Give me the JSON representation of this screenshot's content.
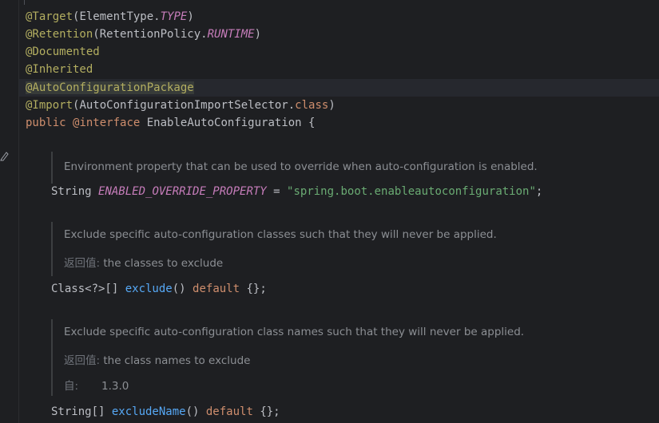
{
  "code": {
    "target": {
      "ann": "@Target",
      "open": "(ElementType.",
      "val": "TYPE",
      "close": ")"
    },
    "retention": {
      "ann": "@Retention",
      "open": "(RetentionPolicy.",
      "val": "RUNTIME",
      "close": ")"
    },
    "documented": "@Documented",
    "inherited": "@Inherited",
    "auto_pkg": "@AutoConfigurationPackage",
    "import": {
      "ann": "@Import",
      "open": "(AutoConfigurationImportSelector.",
      "kw": "class",
      "close": ")"
    },
    "decl": {
      "kw1": "public",
      "kw2": "@interface",
      "name": " EnableAutoConfiguration {"
    },
    "prop": {
      "type": "String ",
      "name": "ENABLED_OVERRIDE_PROPERTY",
      "eq": " = ",
      "value": "\"spring.boot.enableautoconfiguration\"",
      "end": ";"
    },
    "exclude": {
      "type": "Class<?>[] ",
      "name": "exclude",
      "parens": "() ",
      "kw": "default",
      "rest": " {};"
    },
    "exclude_name": {
      "type": "String[] ",
      "name": "excludeName",
      "parens": "() ",
      "kw": "default",
      "rest": " {};"
    }
  },
  "docs": {
    "doc1": "Environment property that can be used to override when auto-configuration is enabled.",
    "doc2": {
      "desc": "Exclude specific auto-configuration classes such that they will never be applied.",
      "returns_label": "返回值:",
      "returns_text": " the classes to exclude"
    },
    "doc3": {
      "desc": "Exclude specific auto-configuration class names such that they will never be applied.",
      "returns_label": "返回值:",
      "returns_text": " the class names to exclude",
      "since_label": "自:",
      "since_value": "1.3.0"
    }
  },
  "colors": {
    "background": "#1e1f22",
    "annotation": "#b3ae60",
    "keyword": "#cf8e6d",
    "constant": "#c77dbb",
    "string": "#6aab73",
    "method": "#56a8f5"
  },
  "icons": {
    "gutter": "edit-pencil-icon"
  }
}
